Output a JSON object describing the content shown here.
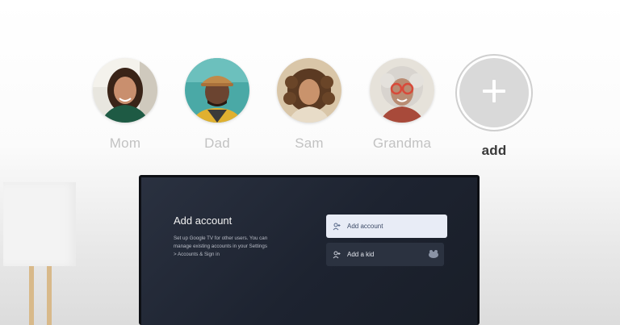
{
  "profiles": [
    {
      "name": "Mom",
      "icon": "person-avatar-photo"
    },
    {
      "name": "Dad",
      "icon": "person-avatar-photo"
    },
    {
      "name": "Sam",
      "icon": "person-avatar-photo"
    },
    {
      "name": "Grandma",
      "icon": "person-avatar-photo"
    }
  ],
  "add_profile": {
    "label": "add",
    "icon": "plus-icon"
  },
  "tv_screen": {
    "title": "Add account",
    "description": "Set up Google TV for other users. You can manage existing accounts in your Settings > Accounts & Sign in",
    "options": [
      {
        "label": "Add account",
        "icon": "add-person-icon",
        "selected": true
      },
      {
        "label": "Add a kid",
        "icon": "add-person-icon",
        "selected": false
      }
    ]
  },
  "colors": {
    "accent_selected_bg": "#e8ecf6",
    "screen_bg": "#1d2330",
    "inactive_label": "#c2c2c2",
    "active_label": "#3a3a3a"
  }
}
